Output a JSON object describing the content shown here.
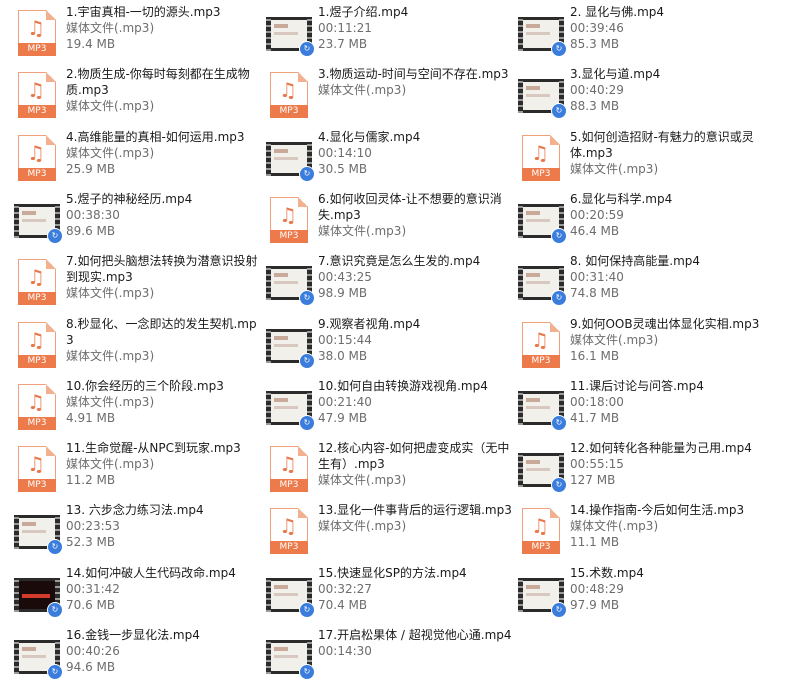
{
  "columns": [
    [
      {
        "name": "1.宇宙真相-一切的源头.mp3",
        "kind": "mp3",
        "meta": [
          "媒体文件(.mp3)",
          "19.4 MB"
        ]
      },
      {
        "name": "2.物质生成-你每时每刻都在生成物质.mp3",
        "kind": "mp3",
        "meta": [
          "媒体文件(.mp3)"
        ]
      },
      {
        "name": "4.高维能量的真相-如何运用.mp3",
        "kind": "mp3",
        "meta": [
          "媒体文件(.mp3)",
          "25.9 MB"
        ]
      },
      {
        "name": "5.煜子的神秘经历.mp4",
        "kind": "mp4",
        "meta": [
          "00:38:30",
          "89.6 MB"
        ]
      },
      {
        "name": "7.如何把头脑想法转换为潜意识投射到现实.mp3",
        "kind": "mp3",
        "meta": [
          "媒体文件(.mp3)"
        ]
      },
      {
        "name": "8.秒显化、一念即达的发生契机.mp3",
        "kind": "mp3",
        "meta": [
          "媒体文件(.mp3)"
        ]
      },
      {
        "name": "10.你会经历的三个阶段.mp3",
        "kind": "mp3",
        "meta": [
          "媒体文件(.mp3)",
          "4.91 MB"
        ]
      },
      {
        "name": "11.生命觉醒-从NPC到玩家.mp3",
        "kind": "mp3",
        "meta": [
          "媒体文件(.mp3)",
          "11.2 MB"
        ]
      },
      {
        "name": "13. 六步念力练习法.mp4",
        "kind": "mp4",
        "meta": [
          "00:23:53",
          "52.3 MB"
        ]
      },
      {
        "name": "14.如何冲破人生代码改命.mp4",
        "kind": "mp4dark",
        "meta": [
          "00:31:42",
          "70.6 MB"
        ]
      },
      {
        "name": "16.金钱一步显化法.mp4",
        "kind": "mp4",
        "meta": [
          "00:40:26",
          "94.6 MB"
        ]
      }
    ],
    [
      {
        "name": "1.煜子介绍.mp4",
        "kind": "mp4",
        "meta": [
          "00:11:21",
          "23.7 MB"
        ]
      },
      {
        "name": "3.物质运动-时间与空间不存在.mp3",
        "kind": "mp3",
        "meta": [
          "媒体文件(.mp3)"
        ]
      },
      {
        "name": "4.显化与儒家.mp4",
        "kind": "mp4",
        "meta": [
          "00:14:10",
          "30.5 MB"
        ]
      },
      {
        "name": "6.如何收回灵体-让不想要的意识消失.mp3",
        "kind": "mp3",
        "meta": [
          "媒体文件(.mp3)"
        ]
      },
      {
        "name": "7.意识究竟是怎么生发的.mp4",
        "kind": "mp4",
        "meta": [
          "00:43:25",
          "98.9 MB"
        ]
      },
      {
        "name": "9.观察者视角.mp4",
        "kind": "mp4",
        "meta": [
          "00:15:44",
          "38.0 MB"
        ]
      },
      {
        "name": "10.如何自由转换游戏视角.mp4",
        "kind": "mp4",
        "meta": [
          "00:21:40",
          "47.9 MB"
        ]
      },
      {
        "name": "12.核心内容-如何把虚变成实（无中生有）.mp3",
        "kind": "mp3",
        "meta": [
          "媒体文件(.mp3)"
        ]
      },
      {
        "name": "13.显化一件事背后的运行逻辑.mp3",
        "kind": "mp3",
        "meta": [
          "媒体文件(.mp3)"
        ]
      },
      {
        "name": "15.快速显化SP的方法.mp4",
        "kind": "mp4",
        "meta": [
          "00:32:27",
          "70.4 MB"
        ]
      },
      {
        "name": "17.开启松果体 / 超视觉他心通.mp4",
        "kind": "mp4",
        "meta": [
          "00:14:30"
        ]
      }
    ],
    [
      {
        "name": "2. 显化与佛.mp4",
        "kind": "mp4",
        "meta": [
          "00:39:46",
          "85.3 MB"
        ]
      },
      {
        "name": "3.显化与道.mp4",
        "kind": "mp4",
        "meta": [
          "00:40:29",
          "88.3 MB"
        ]
      },
      {
        "name": "5.如何创造招财-有魅力的意识或灵体.mp3",
        "kind": "mp3",
        "meta": [
          "媒体文件(.mp3)"
        ]
      },
      {
        "name": "6.显化与科学.mp4",
        "kind": "mp4",
        "meta": [
          "00:20:59",
          "46.4 MB"
        ]
      },
      {
        "name": "8. 如何保持高能量.mp4",
        "kind": "mp4",
        "meta": [
          "00:31:40",
          "74.8 MB"
        ]
      },
      {
        "name": "9.如何OOB灵魂出体显化实相.mp3",
        "kind": "mp3",
        "meta": [
          "媒体文件(.mp3)",
          "16.1 MB"
        ]
      },
      {
        "name": "11.课后讨论与问答.mp4",
        "kind": "mp4",
        "meta": [
          "00:18:00",
          "41.7 MB"
        ]
      },
      {
        "name": "12.如何转化各种能量为己用.mp4",
        "kind": "mp4",
        "meta": [
          "00:55:15",
          "127 MB"
        ]
      },
      {
        "name": "14.操作指南-今后如何生活.mp3",
        "kind": "mp3",
        "meta": [
          "媒体文件(.mp3)",
          "11.1 MB"
        ]
      },
      {
        "name": "15.术数.mp4",
        "kind": "mp4",
        "meta": [
          "00:48:29",
          "97.9 MB"
        ]
      }
    ]
  ],
  "icon_labels": {
    "mp3": "MP3"
  },
  "colors": {
    "mp3_accent": "#ec7a4a",
    "play_badge": "#3b7ddd",
    "meta_text": "#6d6d6d"
  }
}
